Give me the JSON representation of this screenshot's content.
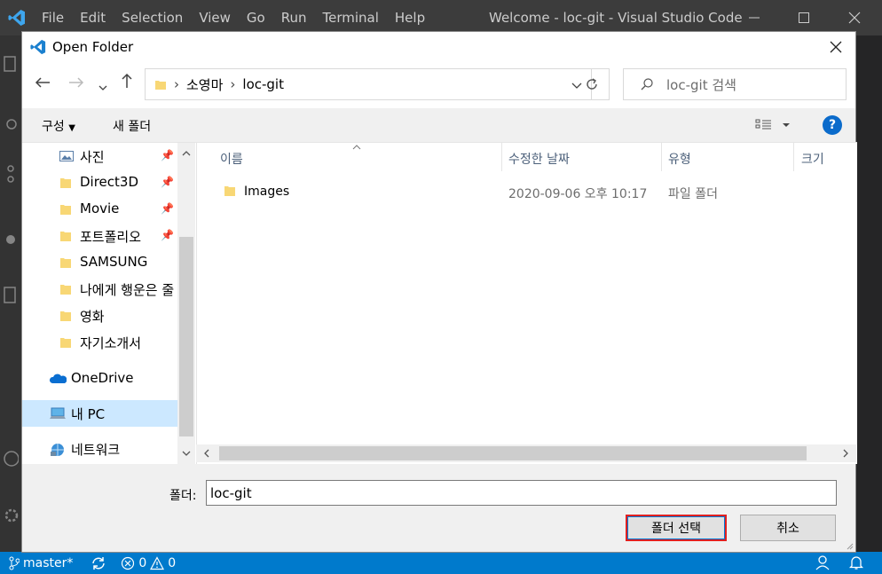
{
  "vscode": {
    "menu": [
      "File",
      "Edit",
      "Selection",
      "View",
      "Go",
      "Run",
      "Terminal",
      "Help"
    ],
    "window_title": "Welcome - loc-git - Visual Studio Code"
  },
  "statusbar": {
    "branch": "master*",
    "errors": "0",
    "warnings": "0"
  },
  "dialog": {
    "title": "Open Folder",
    "breadcrumb": [
      "소영마",
      "loc-git"
    ],
    "search_placeholder": "loc-git 검색",
    "organize_label": "구성",
    "new_folder_label": "새 폴더",
    "nav_items": [
      {
        "label": "사진",
        "icon": "pictures-icon",
        "pinned": true
      },
      {
        "label": "Direct3D",
        "icon": "folder-icon",
        "pinned": true
      },
      {
        "label": "Movie",
        "icon": "folder-icon",
        "pinned": true
      },
      {
        "label": "포트폴리오",
        "icon": "folder-icon",
        "pinned": true
      },
      {
        "label": "SAMSUNG",
        "icon": "folder-icon",
        "pinned": false
      },
      {
        "label": "나에게 행운은 줄",
        "icon": "folder-icon",
        "pinned": false
      },
      {
        "label": "영화",
        "icon": "folder-icon",
        "pinned": false
      },
      {
        "label": "자기소개서",
        "icon": "folder-icon",
        "pinned": false
      }
    ],
    "nav_locations": [
      {
        "label": "OneDrive",
        "icon": "onedrive-icon"
      },
      {
        "label": "내 PC",
        "icon": "pc-icon",
        "selected": true
      },
      {
        "label": "네트워크",
        "icon": "network-icon"
      }
    ],
    "columns": {
      "name": "이름",
      "modified": "수정한 날짜",
      "type": "유형",
      "size": "크기"
    },
    "files": [
      {
        "name": "Images",
        "modified": "2020-09-06 오후 10:17",
        "type": "파일 폴더"
      }
    ],
    "folder_label": "폴더:",
    "folder_value": "loc-git",
    "select_button": "폴더 선택",
    "cancel_button": "취소"
  },
  "colors": {
    "accent": "#007acc",
    "highlight_border": "#e02020",
    "folder": "#f8d775"
  }
}
